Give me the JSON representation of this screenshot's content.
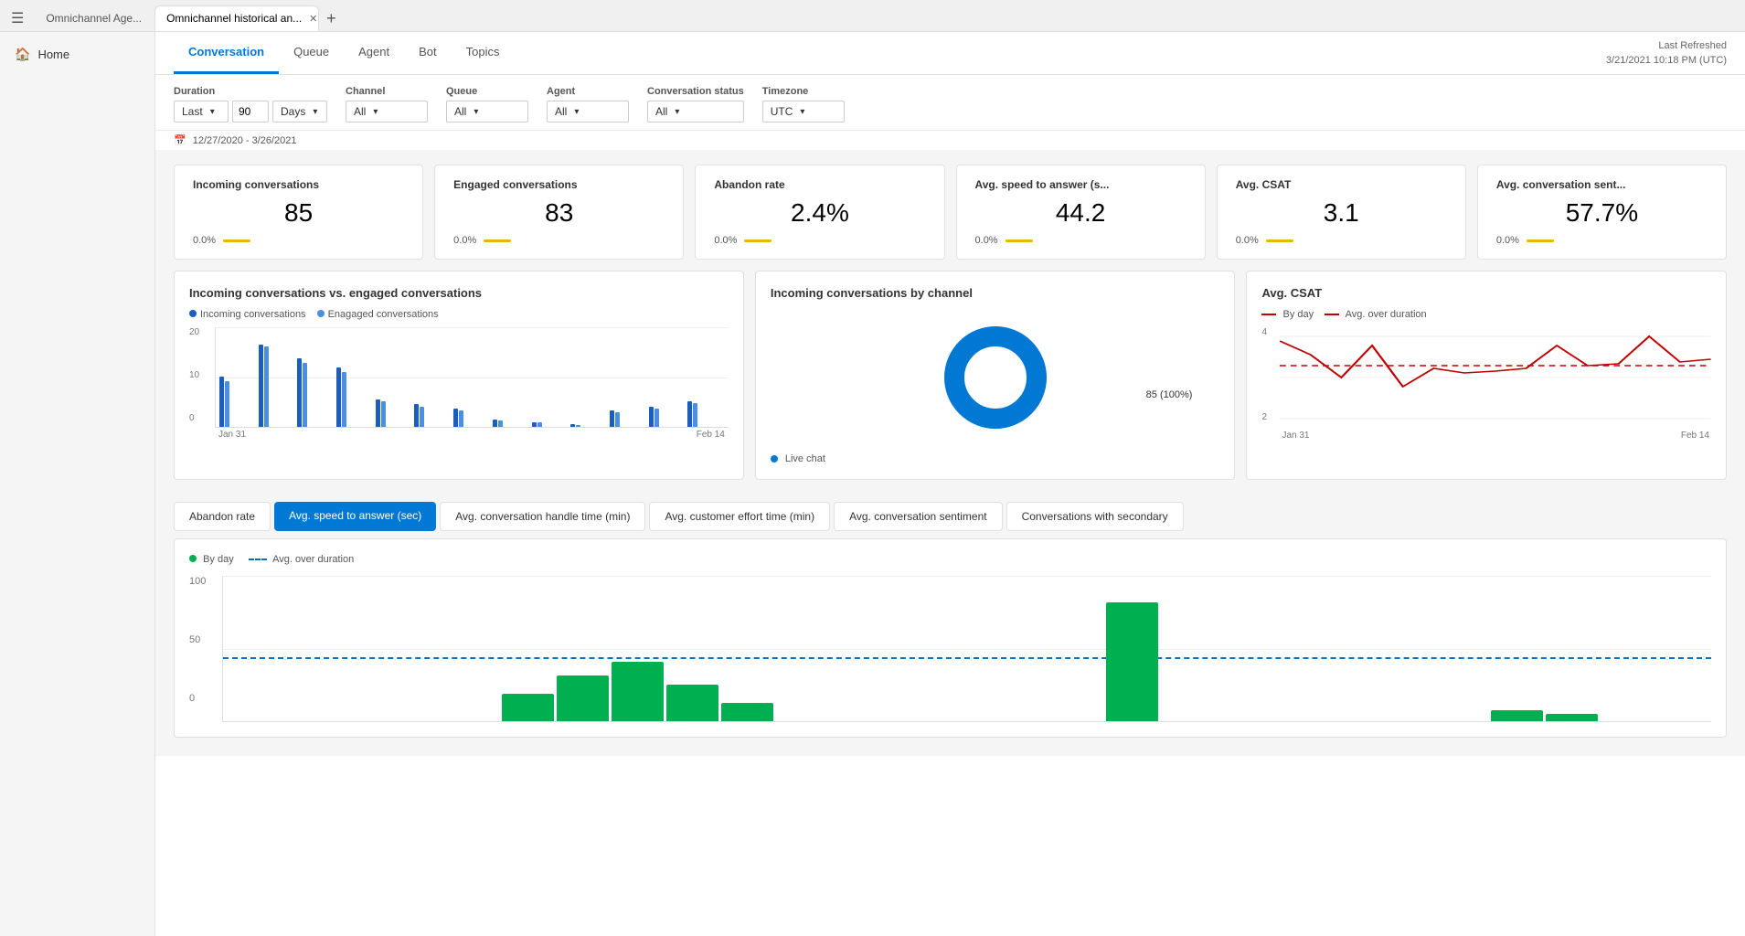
{
  "browser": {
    "hamburger": "☰",
    "tabs": [
      {
        "id": "tab1",
        "label": "Omnichannel Age...",
        "active": false,
        "closable": false
      },
      {
        "id": "tab2",
        "label": "Omnichannel historical an...",
        "active": true,
        "closable": true
      }
    ],
    "addTab": "+"
  },
  "sidebar": {
    "items": [
      {
        "id": "home",
        "label": "Home",
        "icon": "🏠"
      }
    ]
  },
  "header": {
    "tabs": [
      {
        "id": "conversation",
        "label": "Conversation",
        "active": true
      },
      {
        "id": "queue",
        "label": "Queue",
        "active": false
      },
      {
        "id": "agent",
        "label": "Agent",
        "active": false
      },
      {
        "id": "bot",
        "label": "Bot",
        "active": false
      },
      {
        "id": "topics",
        "label": "Topics",
        "active": false
      }
    ],
    "lastRefreshed": {
      "label": "Last Refreshed",
      "value": "3/21/2021 10:18 PM (UTC)"
    }
  },
  "filters": {
    "duration": {
      "label": "Duration",
      "preset": "Last",
      "value": "90",
      "unit": "Days"
    },
    "channel": {
      "label": "Channel",
      "value": "All"
    },
    "queue": {
      "label": "Queue",
      "value": "All"
    },
    "agent": {
      "label": "Agent",
      "value": "All"
    },
    "conversationStatus": {
      "label": "Conversation status",
      "value": "All"
    },
    "timezone": {
      "label": "Timezone",
      "value": "UTC"
    },
    "dateRange": "12/27/2020 - 3/26/2021"
  },
  "kpis": [
    {
      "id": "incoming",
      "title": "Incoming conversations",
      "value": "85",
      "delta": "0.0%",
      "bar": true
    },
    {
      "id": "engaged",
      "title": "Engaged conversations",
      "value": "83",
      "delta": "0.0%",
      "bar": true
    },
    {
      "id": "abandon",
      "title": "Abandon rate",
      "value": "2.4%",
      "delta": "0.0%",
      "bar": true
    },
    {
      "id": "speed",
      "title": "Avg. speed to answer (s...",
      "value": "44.2",
      "delta": "0.0%",
      "bar": true
    },
    {
      "id": "csat",
      "title": "Avg. CSAT",
      "value": "3.1",
      "delta": "0.0%",
      "bar": true
    },
    {
      "id": "sentiment",
      "title": "Avg. conversation sent...",
      "value": "57.7%",
      "delta": "0.0%",
      "bar": true
    }
  ],
  "charts": {
    "barChart": {
      "title": "Incoming conversations vs. engaged conversations",
      "legend": [
        {
          "label": "Incoming conversations",
          "color": "#1B5EBE"
        },
        {
          "label": "Enagaged conversations",
          "color": "#4A90E2"
        }
      ],
      "xLabels": [
        "Jan 31",
        "Feb 14"
      ],
      "yMax": 20,
      "yMid": 10,
      "yMin": 0
    },
    "donutChart": {
      "title": "Incoming conversations by channel",
      "segments": [
        {
          "label": "Live chat",
          "value": 85,
          "percent": 100,
          "color": "#0078d4"
        }
      ],
      "centerLabel": "85 (100%)"
    },
    "lineChart": {
      "title": "Avg. CSAT",
      "legend": [
        {
          "label": "By day",
          "color": "#c00000",
          "style": "solid"
        },
        {
          "label": "Avg. over duration",
          "color": "#c00000",
          "style": "dashed"
        }
      ],
      "xLabels": [
        "Jan 31",
        "Feb 14"
      ],
      "yLabels": [
        "4",
        "2"
      ]
    }
  },
  "bottomTabs": [
    {
      "id": "abandon",
      "label": "Abandon rate",
      "active": false
    },
    {
      "id": "speed",
      "label": "Avg. speed to answer (sec)",
      "active": true
    },
    {
      "id": "handle",
      "label": "Avg. conversation handle time (min)",
      "active": false
    },
    {
      "id": "effort",
      "label": "Avg. customer effort time (min)",
      "active": false
    },
    {
      "id": "sentiment",
      "label": "Avg. conversation sentiment",
      "active": false
    },
    {
      "id": "secondary",
      "label": "Conversations with secondary",
      "active": false
    }
  ],
  "bottomChart": {
    "legend": [
      {
        "label": "By day",
        "color": "#00b050",
        "style": "solid"
      },
      {
        "label": "Avg. over duration",
        "color": "#0070c0",
        "style": "dashed"
      }
    ],
    "yLabels": [
      "100",
      "50",
      "0"
    ]
  }
}
